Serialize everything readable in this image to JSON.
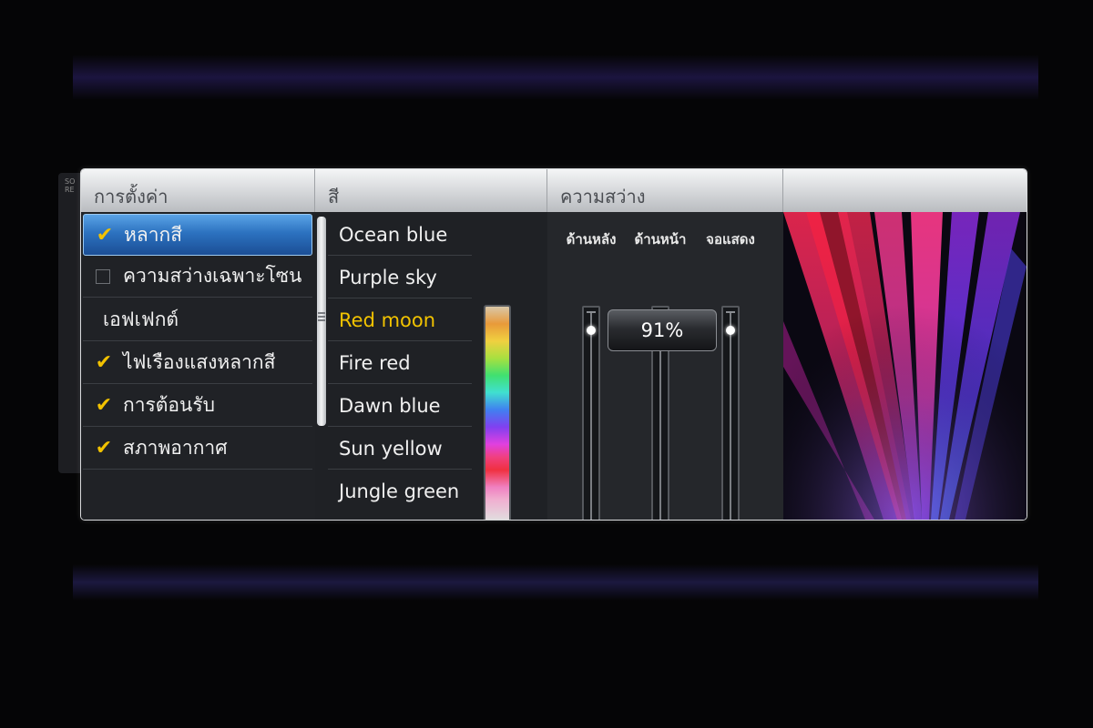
{
  "header": {
    "settings": "การตั้งค่า",
    "color": "สี",
    "brightness": "ความสว่าง"
  },
  "background_panel": {
    "text": "SO\nRE"
  },
  "settings_menu": {
    "items": [
      {
        "label": "หลากสี",
        "checked": true,
        "selected": true
      },
      {
        "label": "ความสว่างเฉพาะโซน",
        "checked": false
      },
      {
        "label": "เอฟเฟกต์",
        "heading": true
      },
      {
        "label": "ไฟเรืองแสงหลากสี",
        "checked": true
      },
      {
        "label": "การต้อนรับ",
        "checked": true
      },
      {
        "label": "สภาพอากาศ",
        "checked": true
      }
    ],
    "check_glyph": "✔",
    "back_glyph": "⮌"
  },
  "color_list": {
    "items": [
      "Ocean blue",
      "Purple sky",
      "Red moon",
      "Fire red",
      "Dawn blue",
      "Sun yellow",
      "Jungle green"
    ],
    "selected": "Red moon",
    "selected_color": "#f2c300"
  },
  "brightness": {
    "labels": [
      "ด้านหลัง",
      "ด้านหน้า",
      "จอแสดง"
    ],
    "value_text": "91%",
    "value": 91
  },
  "colors": {
    "accent_blue": "#2c72c0",
    "check_yellow": "#f2c200"
  }
}
